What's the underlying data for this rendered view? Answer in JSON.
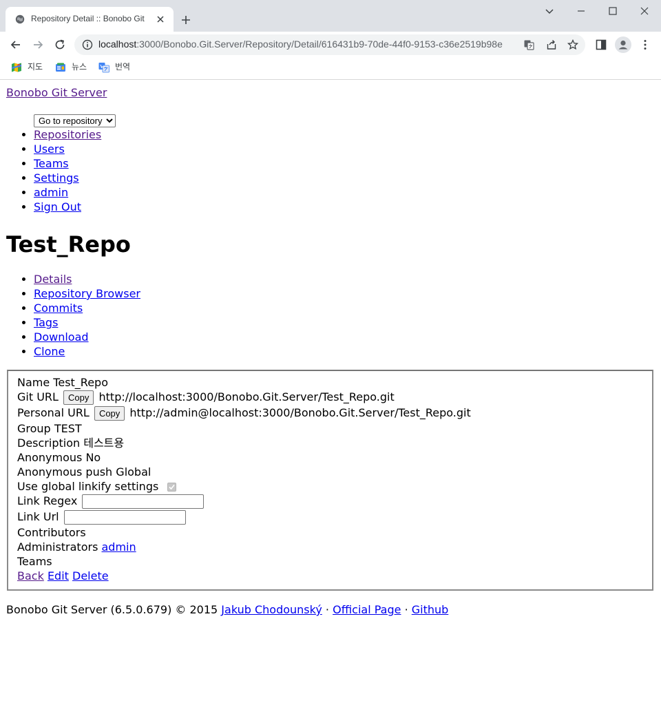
{
  "browser": {
    "tab_title": "Repository Detail :: Bonobo Git",
    "url_host": "localhost",
    "url_path": ":3000/Bonobo.Git.Server/Repository/Detail/616431b9-70de-44f0-9153-c36e2519b98e",
    "bookmarks": [
      {
        "label": "지도",
        "icon": "maps-icon"
      },
      {
        "label": "뉴스",
        "icon": "news-icon"
      },
      {
        "label": "번역",
        "icon": "translate-icon"
      }
    ]
  },
  "site": {
    "brand": "Bonobo Git Server",
    "repo_select": {
      "selected": "Go to repository",
      "options": [
        "Go to repository"
      ]
    },
    "menu": [
      "Repositories",
      "Users",
      "Teams",
      "Settings",
      "admin",
      "Sign Out"
    ]
  },
  "repo": {
    "title": "Test_Repo",
    "tabs": [
      "Details",
      "Repository Browser",
      "Commits",
      "Tags",
      "Download",
      "Clone"
    ],
    "details": {
      "name_label": "Name",
      "name_value": "Test_Repo",
      "git_url_label": "Git URL",
      "copy_label": "Copy",
      "git_url_value": "http://localhost:3000/Bonobo.Git.Server/Test_Repo.git",
      "personal_url_label": "Personal URL",
      "personal_url_value": "http://admin@localhost:3000/Bonobo.Git.Server/Test_Repo.git",
      "group_label": "Group",
      "group_value": "TEST",
      "description_label": "Description",
      "description_value": "테스트용",
      "anonymous_label": "Anonymous",
      "anonymous_value": "No",
      "anonymous_push_label": "Anonymous push",
      "anonymous_push_value": "Global",
      "linkify_label": "Use global linkify settings",
      "linkify_checked": true,
      "link_regex_label": "Link Regex",
      "link_regex_value": "",
      "link_url_label": "Link Url",
      "link_url_value": "",
      "contributors_label": "Contributors",
      "administrators_label": "Administrators",
      "administrators_link": "admin",
      "teams_label": "Teams",
      "actions": [
        "Back",
        "Edit",
        "Delete"
      ]
    }
  },
  "footer": {
    "text": "Bonobo Git Server (6.5.0.679) © 2015",
    "links": [
      "Jakub Chodounský",
      "Official Page",
      "Github"
    ],
    "separator": "·"
  }
}
